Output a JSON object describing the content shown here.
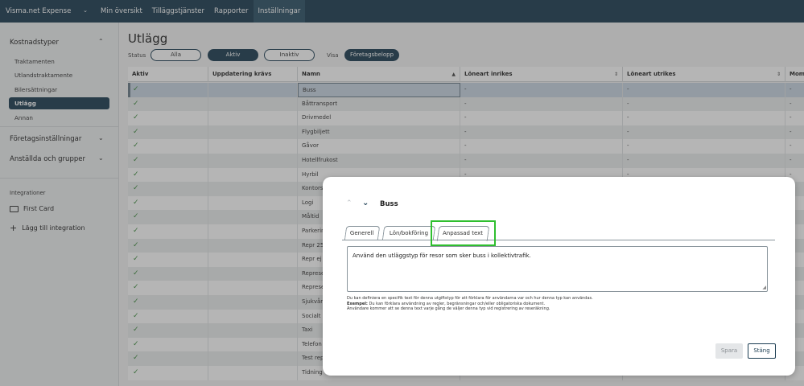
{
  "topnav": {
    "brand": "Visma.net Expense",
    "items": [
      "Min översikt",
      "Tilläggstjänster",
      "Rapporter",
      "Inställningar"
    ]
  },
  "sidebar": {
    "kostnadstyper": "Kostnadstyper",
    "items": [
      "Traktamenten",
      "Utlandstraktamente",
      "Bilersättningar",
      "Utlägg",
      "Annan"
    ],
    "foretagsinstallningar": "Företagsinställningar",
    "anstallda": "Anställda och grupper",
    "integrationer": "Integrationer",
    "first_card": "First Card",
    "add_integration": "Lägg till integration"
  },
  "main": {
    "title": "Utlägg",
    "status_label": "Status",
    "status_options": [
      "Alla",
      "Aktiv",
      "Inaktiv"
    ],
    "visa_label": "Visa",
    "visa_value": "Företagsbelopp"
  },
  "table": {
    "columns": [
      "Aktiv",
      "Uppdatering krävs",
      "Namn",
      "Löneart inrikes",
      "Löneart utrikes",
      "Moms"
    ],
    "rows": [
      {
        "name": "Buss",
        "inrikes": "-",
        "utrikes": "-",
        "moms": "-"
      },
      {
        "name": "Båttransport",
        "inrikes": "-",
        "utrikes": "-",
        "moms": "-"
      },
      {
        "name": "Drivmedel",
        "inrikes": "-",
        "utrikes": "-",
        "moms": "-"
      },
      {
        "name": "Flygbiljett",
        "inrikes": "-",
        "utrikes": "-",
        "moms": "-"
      },
      {
        "name": "Gåvor",
        "inrikes": "-",
        "utrikes": "-",
        "moms": "-"
      },
      {
        "name": "Hotellfrukost",
        "inrikes": "-",
        "utrikes": "-",
        "moms": "-"
      },
      {
        "name": "Hyrbil",
        "inrikes": "-",
        "utrikes": "-",
        "moms": "-"
      },
      {
        "name": "Kontors",
        "inrikes": "",
        "utrikes": "",
        "moms": ""
      },
      {
        "name": "Logi",
        "inrikes": "",
        "utrikes": "",
        "moms": ""
      },
      {
        "name": "Måltid",
        "inrikes": "",
        "utrikes": "",
        "moms": ""
      },
      {
        "name": "Parkerin",
        "inrikes": "",
        "utrikes": "",
        "moms": ""
      },
      {
        "name": "Repr 25",
        "inrikes": "",
        "utrikes": "",
        "moms": ""
      },
      {
        "name": "Repr ej",
        "inrikes": "",
        "utrikes": "",
        "moms": ""
      },
      {
        "name": "Represe",
        "inrikes": "",
        "utrikes": "",
        "moms": ""
      },
      {
        "name": "Represe",
        "inrikes": "",
        "utrikes": "",
        "moms": ""
      },
      {
        "name": "Sjukvår",
        "inrikes": "",
        "utrikes": "",
        "moms": ""
      },
      {
        "name": "Socialt ",
        "inrikes": "",
        "utrikes": "",
        "moms": ""
      },
      {
        "name": "Taxi",
        "inrikes": "",
        "utrikes": "",
        "moms": ""
      },
      {
        "name": "Telefon",
        "inrikes": "",
        "utrikes": "",
        "moms": ""
      },
      {
        "name": "Test rep",
        "inrikes": "",
        "utrikes": "",
        "moms": ""
      },
      {
        "name": "Tidning",
        "inrikes": "",
        "utrikes": "",
        "moms": ""
      }
    ]
  },
  "modal": {
    "title": "Buss",
    "tabs": [
      "Generell",
      "Lön/bokföring",
      "Anpassad text"
    ],
    "active_tab": "Anpassad text",
    "textarea_value": "Använd den utläggstyp för resor som sker buss i kollektivtrafik.",
    "help_line1": "Du kan definiera en specifik text för denna utgiftstyp för att förklara för användarna var och hur denna typ kan användas.",
    "help_example_label": "Exempel:",
    "help_line2": " Du kan förklara användning av regler, begränsningar och/eller obligatoriska dokument.",
    "help_line3": "Användare kommer att se denna text varje gång de väljer denna typ vid registrering av reseräkning.",
    "save_label": "Spara",
    "close_label": "Stäng"
  },
  "colors": {
    "nav": "#1c3d52",
    "highlight": "#2fbf2f",
    "check": "#3a8a3a"
  }
}
